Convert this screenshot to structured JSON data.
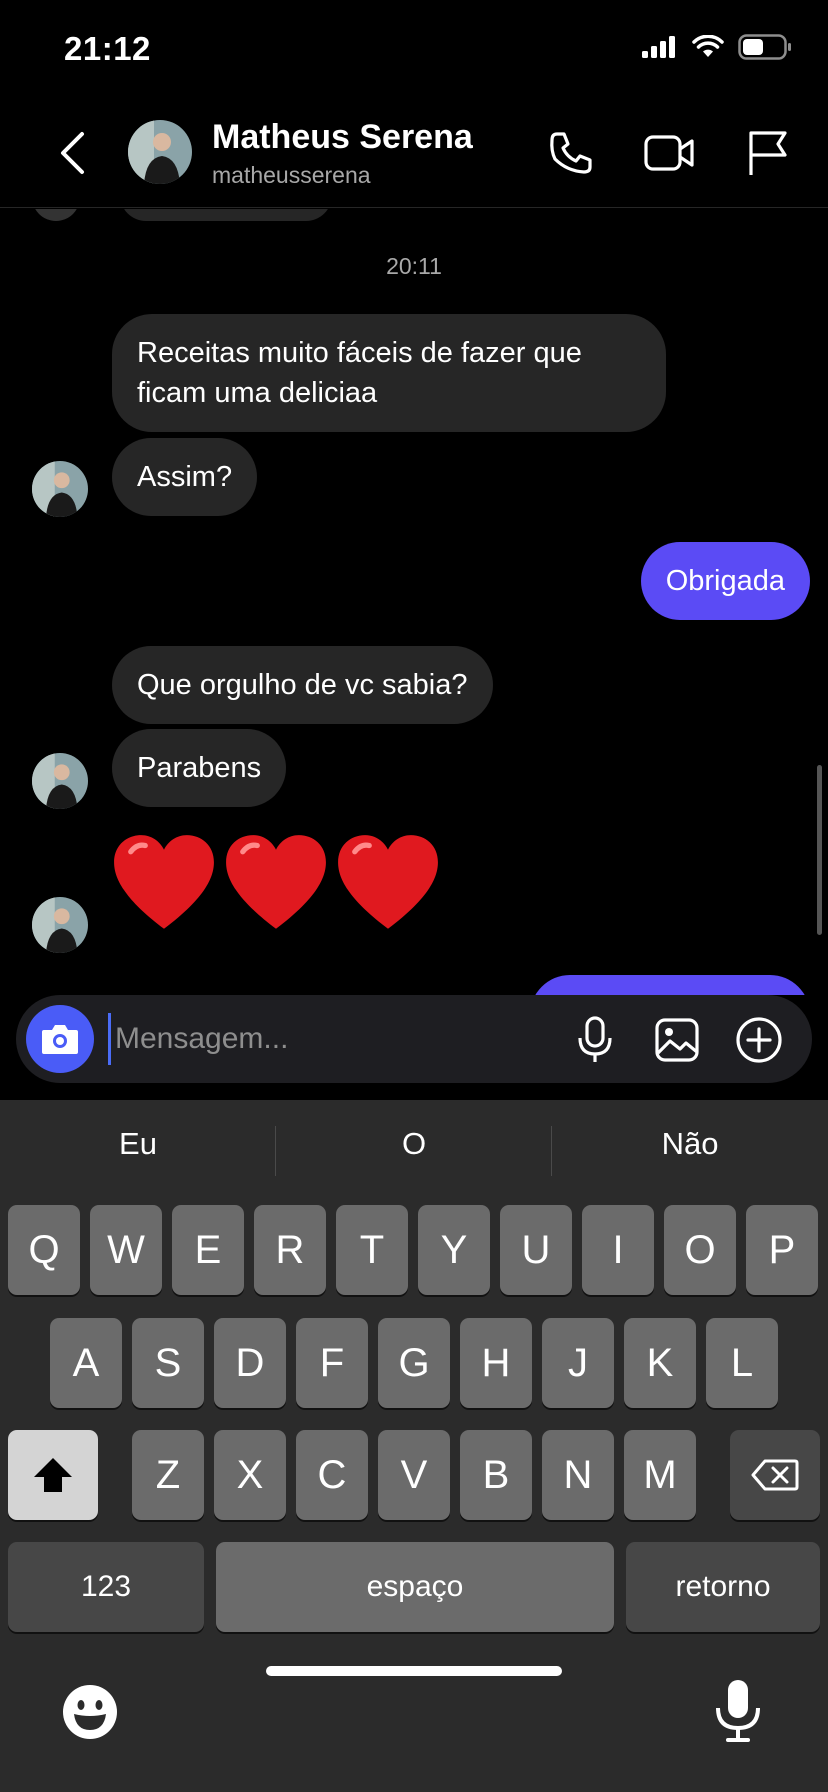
{
  "status_bar": {
    "time": "21:12"
  },
  "header": {
    "back_icon": "chevron-left-icon",
    "contact_name": "Matheus Serena",
    "contact_username": "matheusserena",
    "actions": [
      "phone-icon",
      "video-camera-icon",
      "flag-icon"
    ]
  },
  "chat": {
    "timestamp": "20:11",
    "messages": [
      {
        "from": "them",
        "text": "Receitas muito fáceis de fazer que ficam uma deliciaa"
      },
      {
        "from": "them",
        "text": "Assim?"
      },
      {
        "from": "me",
        "text": "Obrigada"
      },
      {
        "from": "them",
        "text": "Que orgulho de vc sabia?"
      },
      {
        "from": "them",
        "text": "Parabens"
      },
      {
        "from": "them",
        "text": "❤️❤️❤️"
      }
    ]
  },
  "composer": {
    "placeholder": "Mensagem...",
    "icons": [
      "camera-icon",
      "microphone-icon",
      "gallery-icon",
      "plus-circle-icon"
    ]
  },
  "keyboard": {
    "suggestions": [
      "Eu",
      "O",
      "Não"
    ],
    "row1": [
      "Q",
      "W",
      "E",
      "R",
      "T",
      "Y",
      "U",
      "I",
      "O",
      "P"
    ],
    "row2": [
      "A",
      "S",
      "D",
      "F",
      "G",
      "H",
      "J",
      "K",
      "L"
    ],
    "row3": [
      "Z",
      "X",
      "C",
      "V",
      "B",
      "N",
      "M"
    ],
    "numbers_label": "123",
    "space_label": "espaço",
    "return_label": "retorno"
  },
  "colors": {
    "my_bubble": "#5b4bf5",
    "their_bubble": "#262626",
    "camera_button": "#4a5cf7"
  }
}
